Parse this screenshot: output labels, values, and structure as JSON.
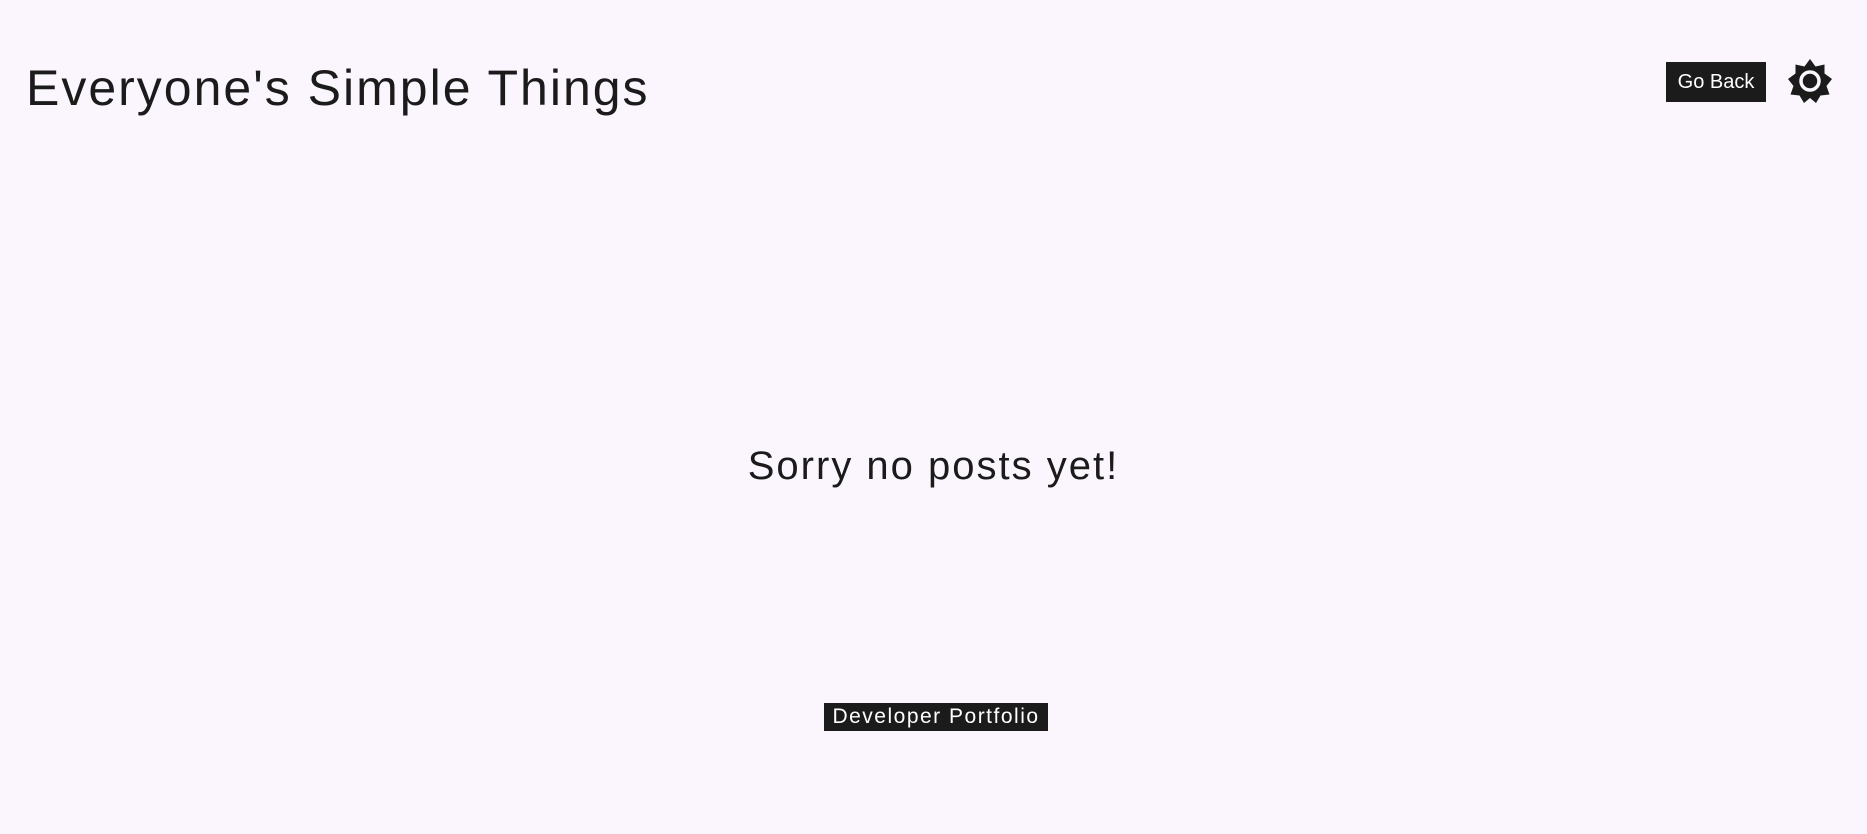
{
  "header": {
    "title": "Everyone's Simple Things",
    "go_back_label": "Go Back",
    "theme_toggle_icon": "sun-icon"
  },
  "main": {
    "empty_message": "Sorry no posts yet!"
  },
  "footer": {
    "developer_link_label": "Developer Portfolio"
  },
  "colors": {
    "background": "#fbf6fd",
    "text": "#1b1b1b",
    "button_bg": "#1b1b1b",
    "button_text": "#ffffff"
  }
}
